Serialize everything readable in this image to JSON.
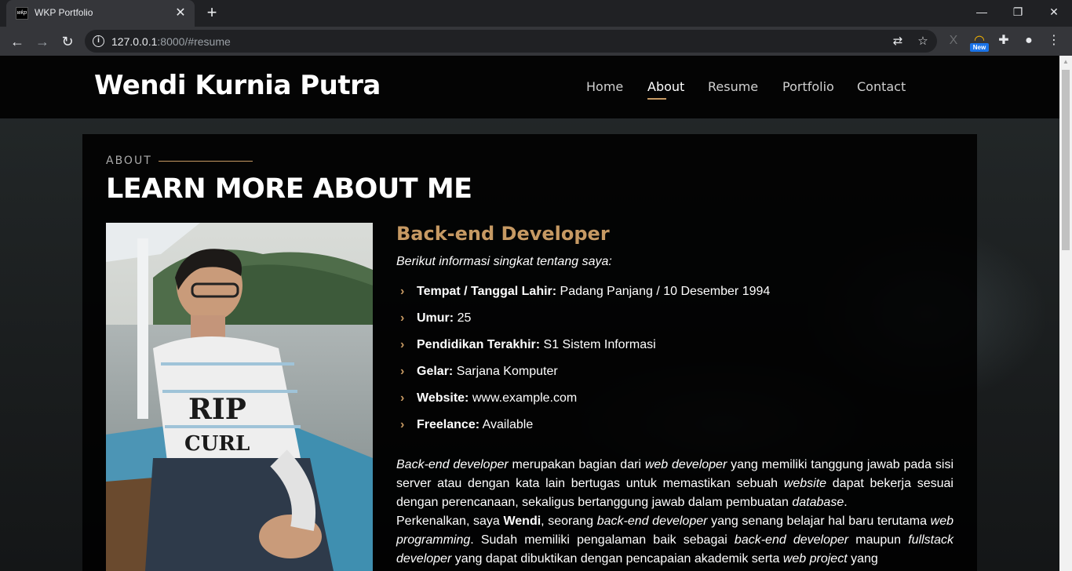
{
  "browser": {
    "tab_title": "WKP Portfolio",
    "tab_favicon_text": "wkp",
    "url_host": "127.0.0.1",
    "url_rest": ":8000/#resume",
    "ext_badge": "New"
  },
  "site": {
    "logo": "Wendi Kurnia Putra",
    "nav": [
      "Home",
      "About",
      "Resume",
      "Portfolio",
      "Contact"
    ],
    "active_nav": "About"
  },
  "about": {
    "kicker": "ABOUT",
    "title": "LEARN MORE ABOUT ME",
    "role": "Back-end Developer",
    "intro": "Berikut informasi singkat tentang saya:",
    "info": [
      {
        "label": "Tempat / Tanggal Lahir:",
        "value": "Padang Panjang / 10 Desember 1994"
      },
      {
        "label": "Umur:",
        "value": "25"
      },
      {
        "label": "Pendidikan Terakhir:",
        "value": "S1 Sistem Informasi"
      },
      {
        "label": "Gelar:",
        "value": "Sarjana Komputer"
      },
      {
        "label": "Website:",
        "value": "www.example.com"
      },
      {
        "label": "Freelance:",
        "value": "Available"
      }
    ],
    "bio": {
      "p1_a": "Back-end developer",
      "p1_b": " merupakan bagian dari ",
      "p1_c": "web developer",
      "p1_d": " yang memiliki tanggung jawab pada sisi server atau dengan kata lain bertugas untuk memastikan sebuah ",
      "p1_e": "website",
      "p1_f": " dapat bekerja sesuai dengan perencanaan, sekaligus bertanggung jawab dalam pembuatan ",
      "p1_g": "database",
      "p1_h": ".",
      "p2_a": "Perkenalkan, saya ",
      "p2_b": "Wendi",
      "p2_c": ", seorang ",
      "p2_d": "back-end developer",
      "p2_e": " yang senang belajar hal baru terutama ",
      "p2_f": "web programming",
      "p2_g": ". Sudah memiliki pengalaman baik sebagai ",
      "p2_h": "back-end developer",
      "p2_i": " maupun ",
      "p2_j": "fullstack developer",
      "p2_k": " yang dapat dibuktikan dengan pencapaian akademik serta ",
      "p2_l": "web project",
      "p2_m": " yang"
    }
  },
  "colors": {
    "accent": "#c69963",
    "header_bg": "#040404"
  }
}
